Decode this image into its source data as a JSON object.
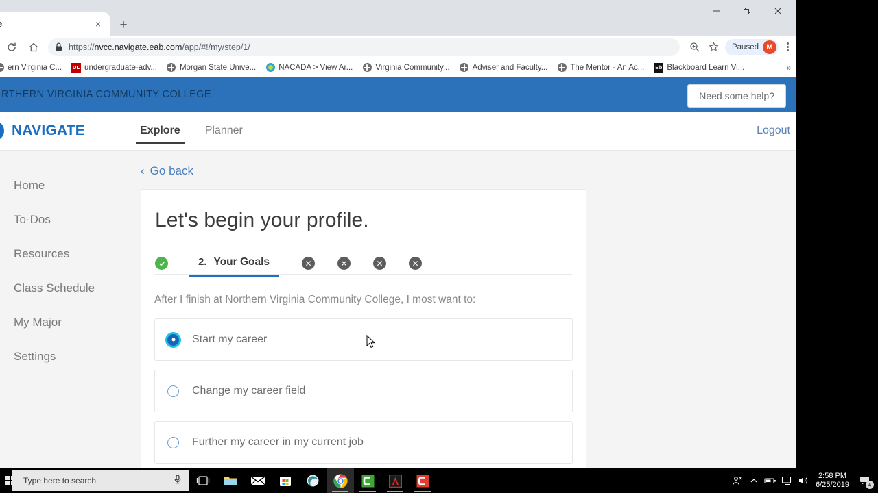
{
  "browser": {
    "tab": {
      "title": "ate",
      "close_label": "×"
    },
    "new_tab_label": "+",
    "window_controls": {
      "minimize": "–",
      "maximize": "❐",
      "close": "✕"
    },
    "url_secure": "https://",
    "url_host": "nvcc.navigate.eab.com",
    "url_path": "/app/#!/my/step/1/",
    "profile": {
      "status": "Paused",
      "avatar_initial": "M"
    },
    "bookmarks": [
      {
        "label": "ern Virginia C...",
        "icon": "globe-favicon"
      },
      {
        "label": "undergraduate-adv...",
        "icon": "ul-favicon",
        "icon_text": "UL"
      },
      {
        "label": "Morgan State Unive...",
        "icon": "globe-favicon"
      },
      {
        "label": "NACADA > View Ar...",
        "icon": "nacada-favicon"
      },
      {
        "label": "Virginia Community...",
        "icon": "globe-favicon"
      },
      {
        "label": "Adviser and Faculty...",
        "icon": "globe-favicon"
      },
      {
        "label": "The Mentor - An Ac...",
        "icon": "globe-favicon"
      },
      {
        "label": "Blackboard Learn Vi...",
        "icon": "blackboard-favicon",
        "icon_text": "Bb"
      }
    ],
    "bookmarks_overflow": "»"
  },
  "page": {
    "college_bar": {
      "college_name": "RTHERN VIRGINIA COMMUNITY COLLEGE",
      "help_button": "Need some help?"
    },
    "header": {
      "brand": "NAVIGATE",
      "tabs": [
        {
          "label": "Explore",
          "active": true
        },
        {
          "label": "Planner",
          "active": false
        }
      ],
      "logout": "Logout"
    },
    "sidebar": {
      "items": [
        {
          "label": "Home",
          "icon": "home-icon"
        },
        {
          "label": "To-Dos",
          "icon": "checklist-icon"
        },
        {
          "label": "Resources",
          "icon": "folder-icon"
        },
        {
          "label": "Class Schedule",
          "icon": "calendar-icon"
        },
        {
          "label": "My Major",
          "icon": "graduation-icon"
        },
        {
          "label": "Settings",
          "icon": "gear-icon"
        }
      ]
    },
    "main": {
      "go_back": "Go back",
      "back_chevron": "‹",
      "title": "Let's begin your profile.",
      "steps": {
        "completed_icon": "check-icon",
        "current_number": "2.",
        "current_label": "Your Goals",
        "remaining_icons": [
          "✕",
          "✕",
          "✕",
          "✕"
        ]
      },
      "question": "After I finish at Northern Virginia Community College, I most want to:",
      "options": [
        {
          "label": "Start my career",
          "selected": true
        },
        {
          "label": "Change my career field",
          "selected": false
        },
        {
          "label": "Further my career in my current job",
          "selected": false
        }
      ]
    }
  },
  "taskbar": {
    "search_placeholder": "Type here to search",
    "apps": [
      {
        "name": "task-view-icon"
      },
      {
        "name": "file-explorer-icon"
      },
      {
        "name": "mail-icon"
      },
      {
        "name": "microsoft-store-icon"
      },
      {
        "name": "edge-icon"
      },
      {
        "name": "chrome-icon"
      },
      {
        "name": "camtasia-editor-icon"
      },
      {
        "name": "adobe-acrobat-icon"
      },
      {
        "name": "camtasia-recorder-icon"
      }
    ],
    "time": "2:58 PM",
    "date": "6/25/2019",
    "notification_count": "4"
  },
  "colors": {
    "college_bar": "#2b72bb",
    "brand_blue": "#1a6dc0",
    "accent_blue": "#1f6fc4",
    "radio_selected": "#1666b7",
    "radio_focus_ring": "#21c1e8",
    "step_complete_green": "#49b749",
    "step_pending_gray": "#5d5d5d",
    "avatar_orange": "#ea4a28"
  }
}
